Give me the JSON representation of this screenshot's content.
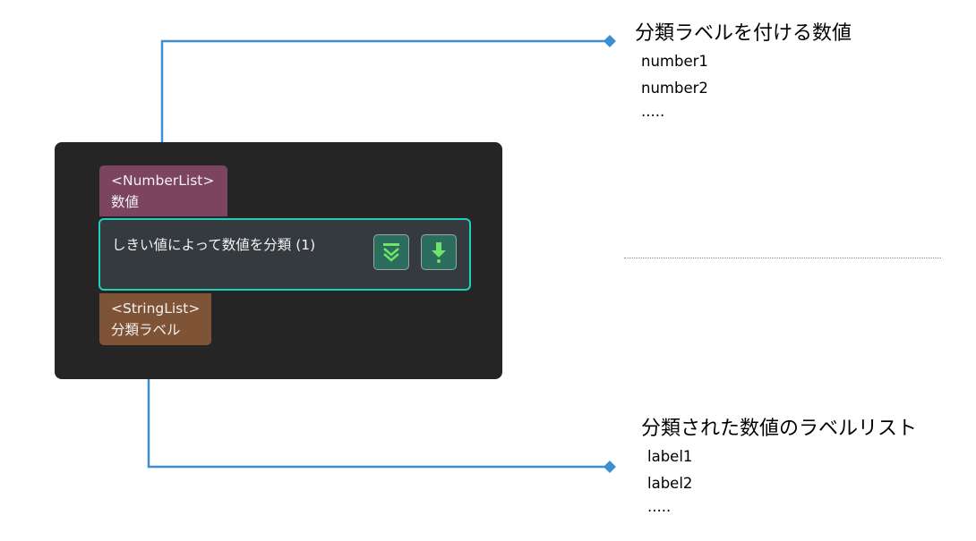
{
  "node": {
    "input_port": {
      "type": "<NumberList>",
      "name": "数値"
    },
    "step_title": "しきい値によって数値を分類 (1)",
    "output_port": {
      "type": "<StringList>",
      "name": "分類ラベル"
    }
  },
  "annotations": {
    "input": {
      "title": "分類ラベルを付ける数値",
      "lines": [
        "number1",
        "number2",
        "....."
      ]
    },
    "output": {
      "title": "分類された数値のラベルリスト",
      "lines": [
        "label1",
        "label2",
        "....."
      ]
    }
  },
  "icons": [
    "chevron-double-down-icon",
    "download-arrow-icon"
  ],
  "colors": {
    "connector": "#3d8fd1",
    "node_background": "#252526",
    "input_port": "#7d4460",
    "output_port": "#7f5336",
    "step_border": "#1fd1b8",
    "step_background": "#353a3f",
    "button_background": "#2b6e5d",
    "button_icon": "#6fe36a"
  }
}
